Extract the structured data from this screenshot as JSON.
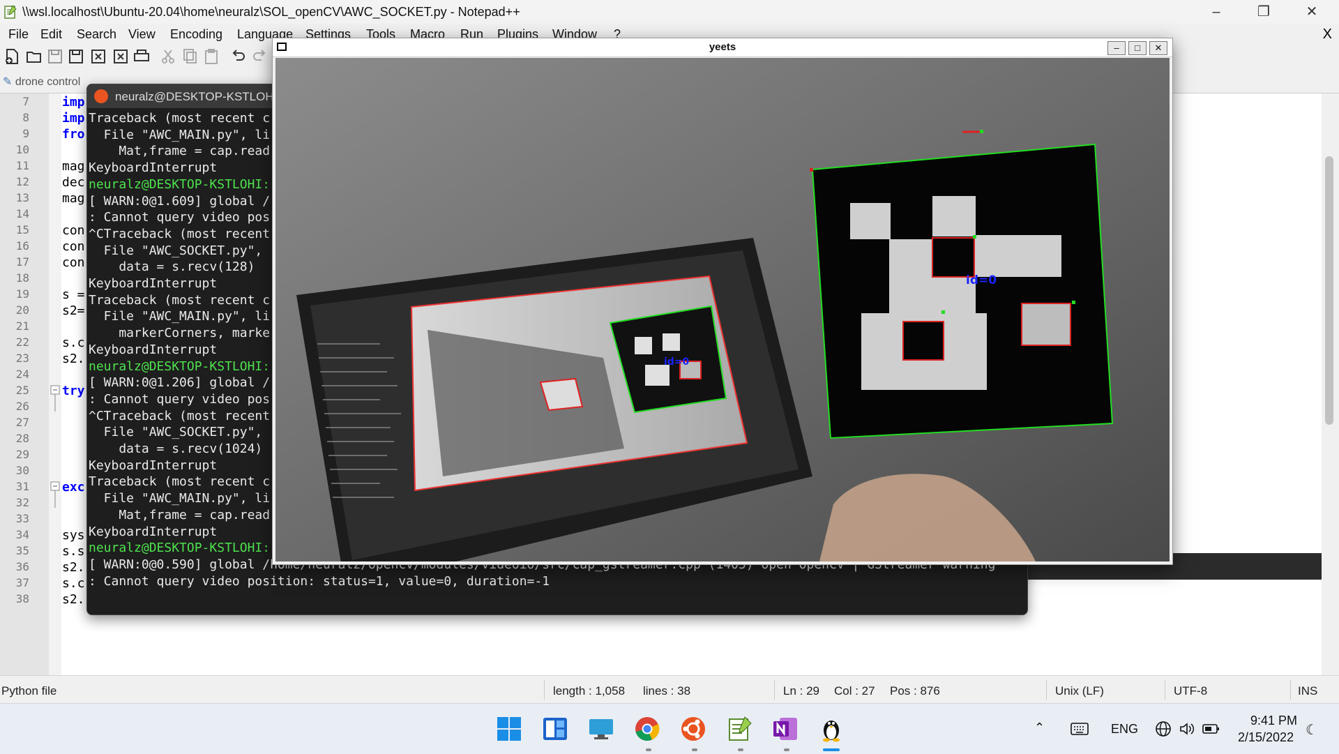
{
  "npp": {
    "title": "\\\\wsl.localhost\\Ubuntu-20.04\\home\\neuralz\\SOL_openCV\\AWC_SOCKET.py - Notepad++",
    "menu": [
      "File",
      "Edit",
      "Search",
      "View",
      "Encoding",
      "Language",
      "Settings",
      "Tools",
      "Macro",
      "Run",
      "Plugins",
      "Window",
      "?"
    ],
    "menu_close": "X",
    "tab_label": "drone control",
    "line_numbers": [
      "7",
      "8",
      "9",
      "10",
      "11",
      "12",
      "13",
      "14",
      "15",
      "16",
      "17",
      "18",
      "19",
      "20",
      "21",
      "22",
      "23",
      "24",
      "25",
      "26",
      "27",
      "28",
      "29",
      "30",
      "31",
      "32",
      "33",
      "34",
      "35",
      "36",
      "37",
      "38"
    ],
    "code_fragments": [
      "imp",
      "imp",
      "fro",
      "mag",
      "dec",
      "mag",
      "con",
      "con",
      "con",
      "s =",
      "s2=",
      "s.c",
      "s2.",
      "try",
      "exc",
      "sys",
      "s.s",
      "s2.",
      "s.c",
      "s2."
    ],
    "status": {
      "file_type": "Python file",
      "length": "length : 1,058",
      "lines": "lines : 38",
      "ln": "Ln : 29",
      "col": "Col : 27",
      "pos": "Pos : 876",
      "eol": "Unix (LF)",
      "encoding": "UTF-8",
      "mode": "INS"
    }
  },
  "terminal": {
    "title": "neuralz@DESKTOP-KSTLOHI:",
    "lines": [
      {
        "text": "Traceback (most recent c",
        "green": false
      },
      {
        "text": "  File \"AWC_MAIN.py\", li",
        "green": false
      },
      {
        "text": "    Mat,frame = cap.read",
        "green": false
      },
      {
        "text": "KeyboardInterrupt",
        "green": false
      },
      {
        "text": "neuralz@DESKTOP-KSTLOHI:",
        "green": true
      },
      {
        "text": "[ WARN:0@1.609] global /",
        "green": false
      },
      {
        "text": ": Cannot query video pos",
        "green": false
      },
      {
        "text": "^CTraceback (most recent",
        "green": false
      },
      {
        "text": "  File \"AWC_SOCKET.py\",",
        "green": false
      },
      {
        "text": "    data = s.recv(128)",
        "green": false
      },
      {
        "text": "KeyboardInterrupt",
        "green": false
      },
      {
        "text": "Traceback (most recent c",
        "green": false
      },
      {
        "text": "  File \"AWC_MAIN.py\", li",
        "green": false
      },
      {
        "text": "    markerCorners, marke",
        "green": false
      },
      {
        "text": "KeyboardInterrupt",
        "green": false
      },
      {
        "text": "neuralz@DESKTOP-KSTLOHI:",
        "green": true
      },
      {
        "text": "[ WARN:0@1.206] global /",
        "green": false
      },
      {
        "text": ": Cannot query video pos",
        "green": false
      },
      {
        "text": "^CTraceback (most recent",
        "green": false
      },
      {
        "text": "  File \"AWC_SOCKET.py\",",
        "green": false
      },
      {
        "text": "    data = s.recv(1024)",
        "green": false
      },
      {
        "text": "KeyboardInterrupt",
        "green": false
      },
      {
        "text": "Traceback (most recent c",
        "green": false
      },
      {
        "text": "  File \"AWC_MAIN.py\", li",
        "green": false
      },
      {
        "text": "    Mat,frame = cap.read",
        "green": false
      },
      {
        "text": "KeyboardInterrupt",
        "green": false
      },
      {
        "text": "neuralz@DESKTOP-KSTLOHI:",
        "green": true
      },
      {
        "text": "[ WARN:0@0.590] global /home/neuralz/opencv/modules/videoio/src/cap_gstreamer.cpp (1405) open OpenCV | GStreamer warning",
        "green": false
      },
      {
        "text": ": Cannot query video position: status=1, value=0, duration=-1",
        "green": false
      }
    ]
  },
  "cv_window": {
    "title": "yeets",
    "marker_label": "id=0",
    "marker_label_small": "id=0"
  },
  "taskbar": {
    "lang": "ENG",
    "time": "9:41 PM",
    "date": "2/15/2022"
  },
  "colors": {
    "terminal_green": "#4ee34e",
    "ubuntu_orange": "#e95420",
    "marker_green": "#22dd22",
    "marker_red": "#dd2222",
    "marker_id_blue": "#1a22ff"
  }
}
